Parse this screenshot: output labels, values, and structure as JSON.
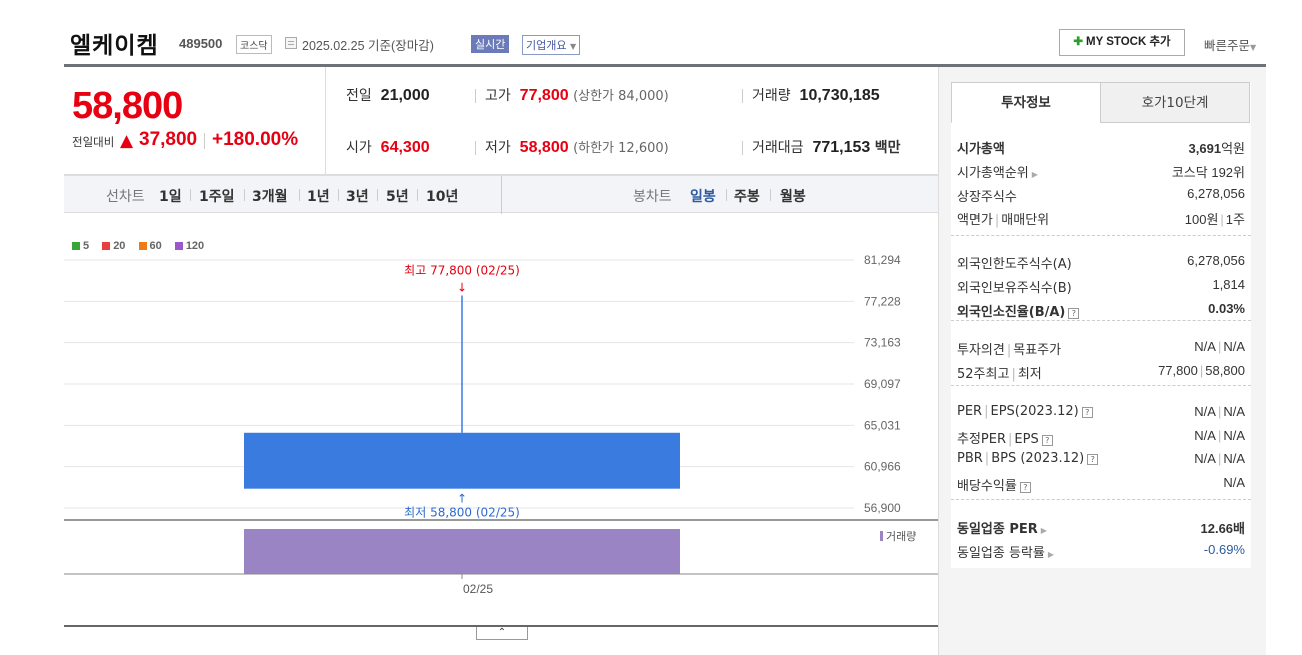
{
  "header": {
    "stock_name": "엘케이켐",
    "stock_code": "489500",
    "market": "코스닥",
    "date_basis": "2025.02.25  기준(장마감)",
    "live_badge": "실시간",
    "company_overview": "기업개요",
    "mystock_button": "MY STOCK 추가",
    "quick_order": "빠른주문"
  },
  "quote": {
    "price": "58,800",
    "change_label": "전일대비",
    "change_arrow": "▲",
    "change_value": "37,800",
    "change_percent": "+180.00%",
    "prev_close_label": "전일",
    "prev_close": "21,000",
    "high_label": "고가",
    "high": "77,800",
    "upper_limit": "(상한가 84,000)",
    "volume_label": "거래량",
    "volume": "10,730,185",
    "open_label": "시가",
    "open": "64,300",
    "low_label": "저가",
    "low": "58,800",
    "lower_limit": "(하한가 12,600)",
    "turnover_label": "거래대금",
    "turnover": "771,153",
    "turnover_unit": "백만"
  },
  "chart_tabs": {
    "line_label": "선차트",
    "line_periods": [
      "1일",
      "1주일",
      "3개월",
      "1년",
      "3년",
      "5년",
      "10년"
    ],
    "candle_label": "봉차트",
    "candle_periods": [
      "일봉",
      "주봉",
      "월봉"
    ],
    "active_candle": "일봉"
  },
  "chart_data": {
    "type": "candlestick",
    "legend": [
      {
        "name": "5",
        "color": "#3aa63a"
      },
      {
        "name": "20",
        "color": "#e84040"
      },
      {
        "name": "60",
        "color": "#f07a1a"
      },
      {
        "name": "120",
        "color": "#9a58c8"
      }
    ],
    "y_ticks": [
      "81,294",
      "77,228",
      "73,163",
      "69,097",
      "65,031",
      "60,966",
      "56,900"
    ],
    "ylim": [
      56900,
      81294
    ],
    "x_ticks": [
      "02/25"
    ],
    "candles": [
      {
        "date": "02/25",
        "open": 64300,
        "high": 77800,
        "low": 58800,
        "close": 58800,
        "volume": 10730185
      }
    ],
    "high_annotation": "최고 77,800 (02/25)",
    "low_annotation": "최저 58,800 (02/25)",
    "volume_label": "거래량",
    "candle_color": "#3a7be0",
    "volume_color": "#9b84c4",
    "down_color": "#2d6bd0",
    "up_color": "#e60012"
  },
  "invest_panel": {
    "tab_info": "투자정보",
    "tab_orderbook": "호가10단계",
    "rows": {
      "market_cap_label": "시가총액",
      "market_cap_value": "3,691",
      "market_cap_unit": "억원",
      "cap_rank_label": "시가총액순위",
      "cap_rank_value": "코스닥 192위",
      "shares_label": "상장주식수",
      "shares_value": "6,278,056",
      "par_label": "액면가",
      "trade_unit_label": "매매단위",
      "par_value": "100원",
      "trade_unit_value": "1주",
      "foreign_limit_label": "외국인한도주식수(A)",
      "foreign_limit_value": "6,278,056",
      "foreign_hold_label": "외국인보유주식수(B)",
      "foreign_hold_value": "1,814",
      "foreign_ratio_label": "외국인소진율(B/A)",
      "foreign_ratio_value": "0.03%",
      "opinion_label": "투자의견",
      "target_label": "목표주가",
      "opinion_value": "N/A",
      "target_value": "N/A",
      "w52_high_label": "52주최고",
      "w52_low_label": "최저",
      "w52_high_value": "77,800",
      "w52_low_value": "58,800",
      "per_label": "PER",
      "eps_label": "EPS(2023.12)",
      "per_value": "N/A",
      "eps_value": "N/A",
      "est_per_label": "추정PER",
      "est_eps_label": "EPS",
      "est_per_value": "N/A",
      "est_eps_value": "N/A",
      "pbr_label": "PBR",
      "bps_label": "BPS (2023.12)",
      "pbr_value": "N/A",
      "bps_value": "N/A",
      "dividend_label": "배당수익률",
      "dividend_value": "N/A",
      "industry_per_label": "동일업종 PER",
      "industry_per_value": "12.66배",
      "industry_rate_label": "동일업종 등락률",
      "industry_rate_value": "-0.69%"
    }
  }
}
